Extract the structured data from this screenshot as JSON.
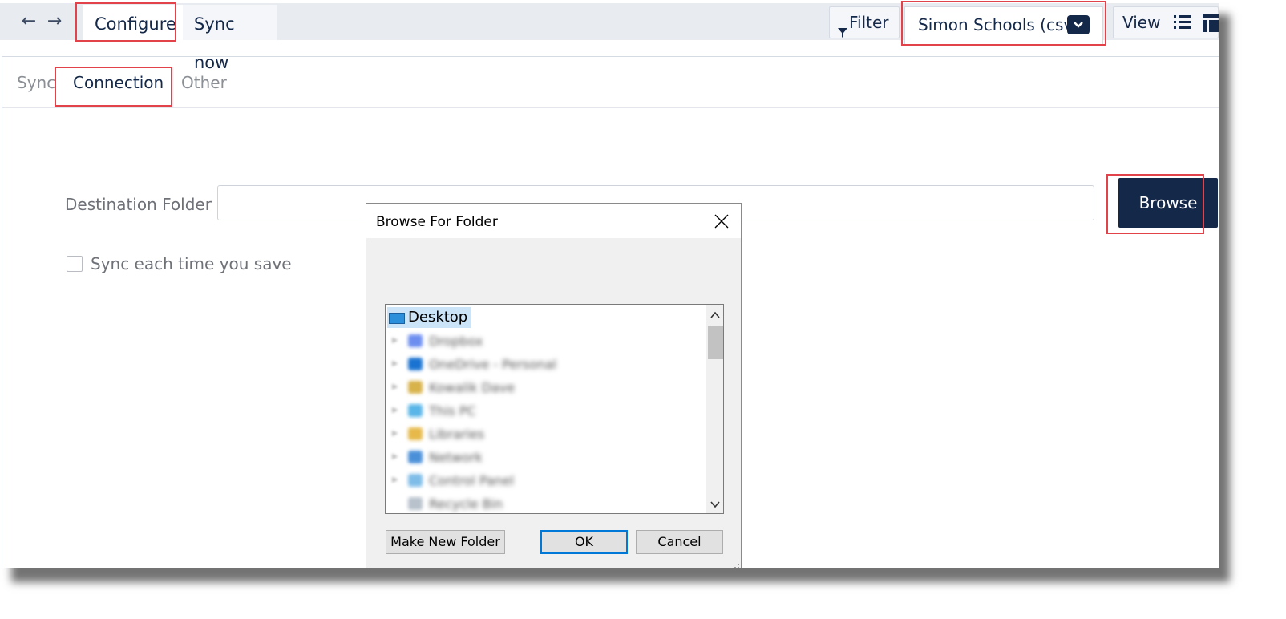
{
  "toolbar": {
    "back_icon": "arrow-left-icon",
    "forward_icon": "arrow-right-icon",
    "tabs": [
      {
        "label": "Configure",
        "active": true
      },
      {
        "label": "Sync now",
        "active": false
      }
    ],
    "filter_label": "Filter",
    "filter_icon": "funnel-icon",
    "datasource_label": "Simon Schools (csv)",
    "datasource_icon": "chevron-down-icon",
    "view_label": "View",
    "view_icons": [
      "list-icon",
      "layout-icon"
    ]
  },
  "subtabs": [
    {
      "label": "Sync",
      "active": false
    },
    {
      "label": "Connection",
      "active": true
    },
    {
      "label": "Other",
      "active": false
    }
  ],
  "form": {
    "destination_label": "Destination Folder",
    "destination_value": "",
    "browse_label": "Browse",
    "sync_each_save_label": "Sync each time you save",
    "sync_each_save_checked": false
  },
  "dialog": {
    "title": "Browse For Folder",
    "tree_root": "Desktop",
    "tree_items": [
      "Dropbox",
      "OneDrive - Personal",
      "Kowalik Dave",
      "This PC",
      "Libraries",
      "Network",
      "Control Panel",
      "Recycle Bin"
    ],
    "make_new_folder_label": "Make New Folder",
    "ok_label": "OK",
    "cancel_label": "Cancel"
  },
  "colors": {
    "primary": "#142849",
    "highlight": "#e2434b",
    "toolbar_bg": "#e8ebf0"
  }
}
